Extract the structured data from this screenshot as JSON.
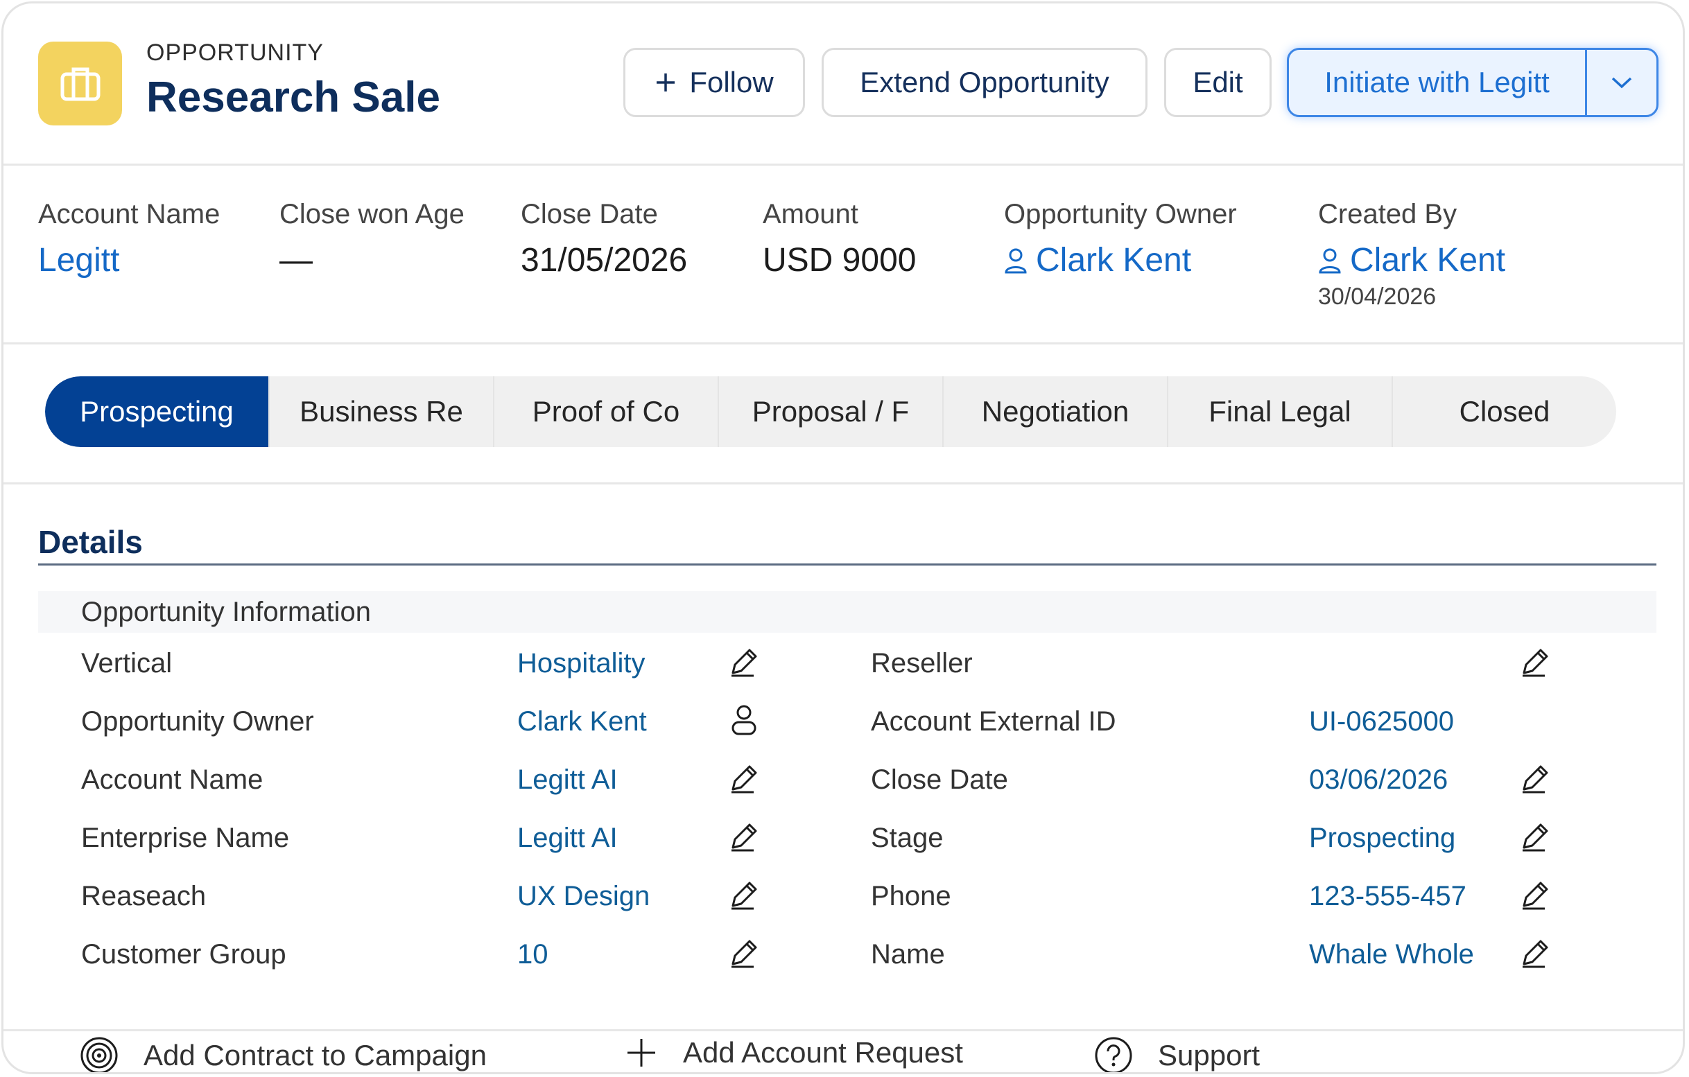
{
  "header": {
    "object_type": "OPPORTUNITY",
    "record_name": "Research Sale",
    "icon": "briefcase-icon",
    "buttons": {
      "follow": "Follow",
      "extend": "Extend Opportunity",
      "edit": "Edit",
      "initiate": "Initiate with Legitt"
    }
  },
  "highlights": [
    {
      "label": "Account Name",
      "value": "Legitt",
      "link": true
    },
    {
      "label": "Close won Age",
      "value": "—",
      "link": false
    },
    {
      "label": "Close Date",
      "value": "31/05/2026",
      "link": false
    },
    {
      "label": "Amount",
      "value": "USD 9000",
      "link": false
    },
    {
      "label": "Opportunity Owner",
      "value": "Clark Kent",
      "link": true,
      "icon": "user-icon"
    },
    {
      "label": "Created By",
      "value": "Clark Kent",
      "link": true,
      "icon": "user-icon",
      "sub": "30/04/2026"
    }
  ],
  "path": {
    "steps": [
      "Prospecting",
      "Business Re",
      "Proof of Co",
      "Proposal / F",
      "Negotiation",
      "Final Legal",
      "Closed"
    ],
    "active_index": 0
  },
  "details": {
    "title": "Details",
    "section": "Opportunity Information",
    "left_fields": [
      {
        "label": "Vertical",
        "value": "Hospitality",
        "icon": "pencil-icon"
      },
      {
        "label": "Opportunity Owner",
        "value": "Clark Kent",
        "icon": "person-icon"
      },
      {
        "label": "Account Name",
        "value": "Legitt AI",
        "icon": "pencil-icon"
      },
      {
        "label": "Enterprise Name",
        "value": "Legitt AI",
        "icon": "pencil-icon"
      },
      {
        "label": "Reaseach",
        "value": "UX Design",
        "icon": "pencil-icon"
      },
      {
        "label": "Customer Group",
        "value": "10",
        "icon": "pencil-icon"
      }
    ],
    "right_fields": [
      {
        "label": "Reseller",
        "value": "",
        "icon": "pencil-icon"
      },
      {
        "label": "Account External ID",
        "value": "UI-0625000",
        "icon": ""
      },
      {
        "label": "Close Date",
        "value": "03/06/2026",
        "icon": "pencil-icon"
      },
      {
        "label": "Stage",
        "value": "Prospecting",
        "icon": "pencil-icon"
      },
      {
        "label": "Phone",
        "value": "123-555-457",
        "icon": "pencil-icon"
      },
      {
        "label": "Name",
        "value": "Whale Whole",
        "icon": "pencil-icon"
      }
    ]
  },
  "footer": [
    {
      "label": "Add Contract to Campaign",
      "icon": "target-icon"
    },
    {
      "label": "Add Account Request",
      "icon": "plus-icon"
    },
    {
      "label": "Support",
      "icon": "help-circle-icon"
    }
  ],
  "colors": {
    "accent_navy": "#034194",
    "link_blue": "#1569c7",
    "field_value_blue": "#0f5d97",
    "logo_yellow": "#f3d35f",
    "primary_button_bg": "#eaf3ff"
  }
}
